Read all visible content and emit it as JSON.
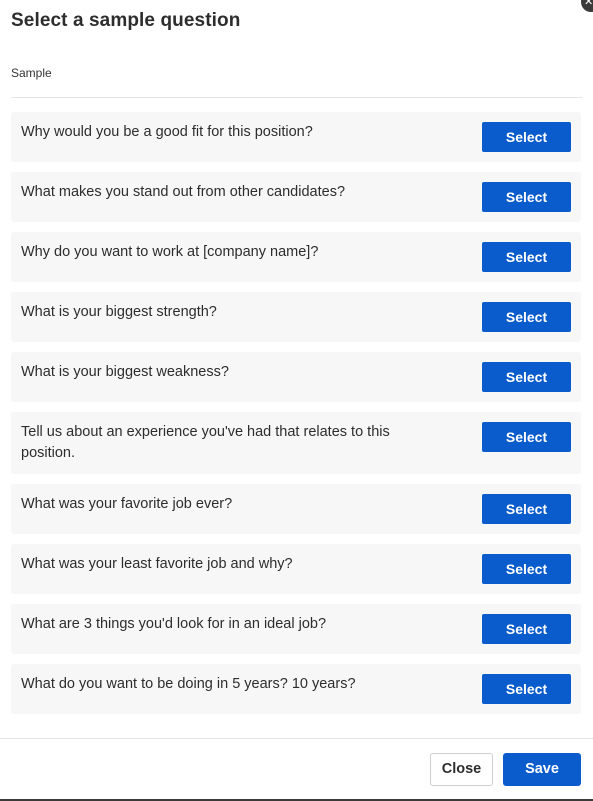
{
  "modal": {
    "title": "Select a sample question",
    "section_label": "Sample",
    "close_icon": "close-icon"
  },
  "questions": [
    {
      "text": "Why would you be a good fit for this position?",
      "button": "Select"
    },
    {
      "text": "What makes you stand out from other candidates?",
      "button": "Select"
    },
    {
      "text": "Why do you want to work at [company name]?",
      "button": "Select"
    },
    {
      "text": "What is your biggest strength?",
      "button": "Select"
    },
    {
      "text": "What is your biggest weakness?",
      "button": "Select"
    },
    {
      "text": "Tell us about an experience you've had that relates to this position.",
      "button": "Select"
    },
    {
      "text": "What was your favorite job ever?",
      "button": "Select"
    },
    {
      "text": "What was your least favorite job and why?",
      "button": "Select"
    },
    {
      "text": "What are 3 things you'd look for in an ideal job?",
      "button": "Select"
    },
    {
      "text": "What do you want to be doing in 5 years? 10 years?",
      "button": "Select"
    }
  ],
  "footer": {
    "close_label": "Close",
    "save_label": "Save"
  },
  "colors": {
    "primary": "#0a5ccc",
    "row_background": "#f7f7f7"
  }
}
